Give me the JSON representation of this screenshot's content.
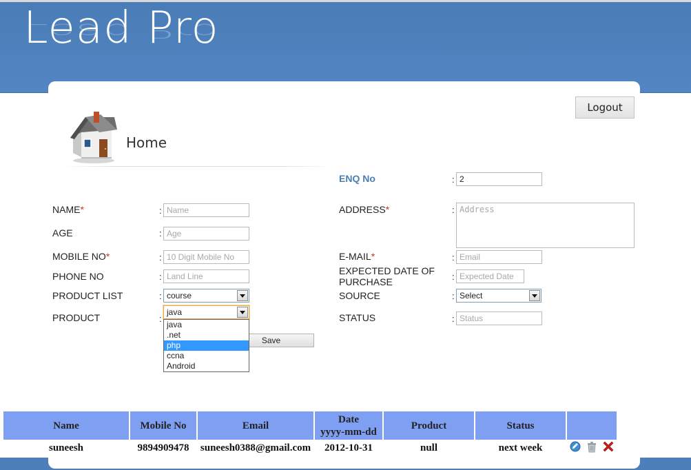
{
  "header": {
    "logo_text": "Lead Pro"
  },
  "toolbar": {
    "logout_label": "Logout"
  },
  "page": {
    "title": "Home"
  },
  "form": {
    "enq_no": {
      "label": "ENQ No",
      "value": "2"
    },
    "name": {
      "label": "NAME",
      "required": "*",
      "placeholder": "Name"
    },
    "age": {
      "label": "AGE",
      "placeholder": "Age"
    },
    "mobile": {
      "label": "MOBILE NO",
      "required": "*",
      "placeholder": "10 Digit Mobile No"
    },
    "phone": {
      "label": "PHONE NO",
      "placeholder": "Land Line"
    },
    "product_list": {
      "label": "PRODUCT LIST",
      "value": "course"
    },
    "product": {
      "label": "PRODUCT",
      "value": "java",
      "options": [
        "java",
        ".net",
        "php",
        "ccna",
        "Android"
      ],
      "highlighted": "php"
    },
    "address": {
      "label": "ADDRESS",
      "required": "*",
      "placeholder": "Address"
    },
    "email": {
      "label": "E-MAIL",
      "required": "*",
      "placeholder": "Email"
    },
    "expected_date": {
      "label": "EXPECTED DATE OF PURCHASE",
      "placeholder": "Expected Date"
    },
    "source": {
      "label": "SOURCE",
      "value": "Select"
    },
    "status": {
      "label": "STATUS",
      "placeholder": "Status"
    },
    "separator": ":",
    "save_label": "Save"
  },
  "table": {
    "headers": [
      "Name",
      "Mobile No",
      "Email",
      "Date",
      "yyyy-mm-dd",
      "Product",
      "Status",
      ""
    ],
    "rows": [
      {
        "name": "suneesh",
        "mobile": "9894909478",
        "email": "suneesh0388@gmail.com",
        "date": "2012-10-31",
        "product": "null",
        "status": "next week"
      }
    ],
    "action_icons": [
      "edit-icon",
      "delete-icon",
      "remove-icon"
    ]
  },
  "colors": {
    "header_blue": "#4d80bb",
    "table_header": "#7f9ff2",
    "label_accent": "#4a7fb4",
    "required_star": "#c0392b",
    "option_highlight": "#3399ff"
  }
}
